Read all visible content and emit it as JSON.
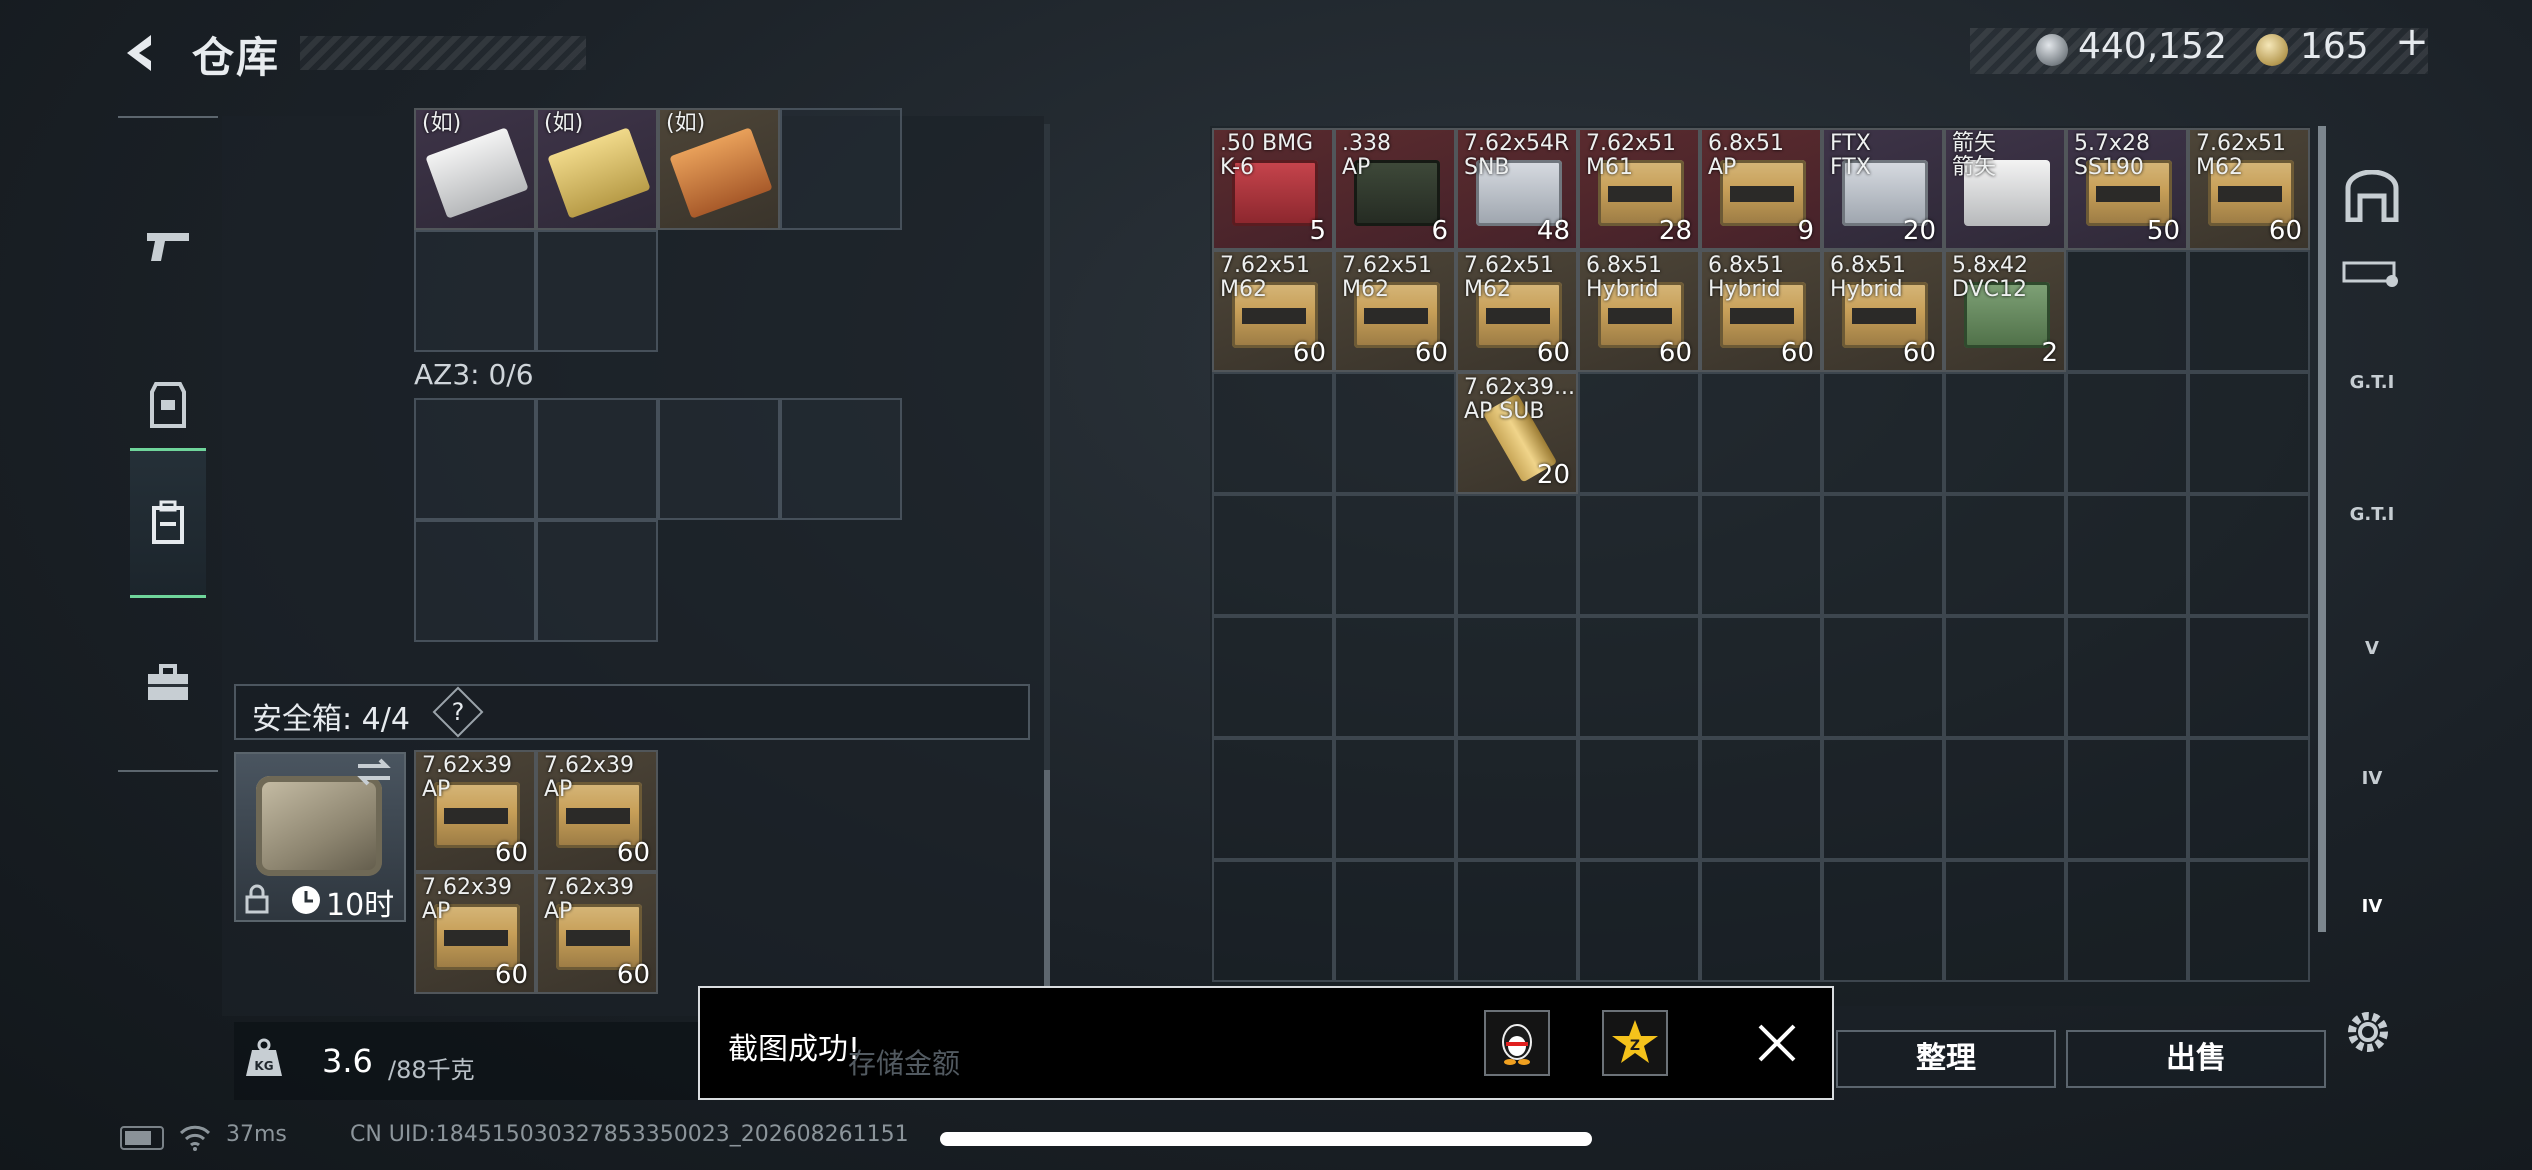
{
  "header": {
    "title": "仓库",
    "silver_amount": "440,152",
    "gold_amount": "165",
    "gold_plus": "+"
  },
  "left_panel": {
    "rig_top_items": [
      {
        "label": "(如)",
        "grade": "purple",
        "art": "pack-white"
      },
      {
        "label": "(如)",
        "grade": "purple",
        "art": "pack-white"
      },
      {
        "label": "(如)",
        "grade": "brown",
        "art": "pack-white"
      }
    ],
    "az3_label": "AZ3: 0/6",
    "safe_label": "安全箱: 4/4",
    "safe_help": "?",
    "safe_timer": "10时",
    "safe_items": [
      {
        "label": "7.62x39\nAP",
        "count": "60"
      },
      {
        "label": "7.62x39\nAP",
        "count": "60"
      },
      {
        "label": "7.62x39\nAP",
        "count": "60"
      },
      {
        "label": "7.62x39\nAP",
        "count": "60"
      }
    ],
    "weight_current": "3.6",
    "weight_max": "/88千克"
  },
  "warehouse": {
    "items": [
      {
        "label": ".50 BMG\nK-6",
        "count": "5",
        "grade": "red",
        "art": "ammo-box-red",
        "col": 0,
        "row": 0
      },
      {
        "label": ".338\nAP",
        "count": "6",
        "grade": "red",
        "art": "ammo-can",
        "col": 1,
        "row": 0
      },
      {
        "label": "7.62x54R\nSNB",
        "count": "48",
        "grade": "red",
        "art": "ammo-box-silver",
        "col": 2,
        "row": 0
      },
      {
        "label": "7.62x51\nM61",
        "count": "28",
        "grade": "red",
        "art": "ammo-box",
        "col": 3,
        "row": 0
      },
      {
        "label": "6.8x51\nAP",
        "count": "9",
        "grade": "red",
        "art": "ammo-box",
        "col": 4,
        "row": 0
      },
      {
        "label": "FTX\nFTX",
        "count": "20",
        "grade": "purple",
        "art": "ammo-box-silver",
        "col": 5,
        "row": 0
      },
      {
        "label": "箭矢\n箭矢",
        "count": "",
        "grade": "purple",
        "art": "pack-white",
        "col": 6,
        "row": 0
      },
      {
        "label": "5.7x28\nSS190",
        "count": "50",
        "grade": "purple",
        "art": "ammo-box",
        "col": 7,
        "row": 0
      },
      {
        "label": "7.62x51\nM62",
        "count": "60",
        "grade": "brown",
        "art": "ammo-box",
        "col": 8,
        "row": 0
      },
      {
        "label": "7.62x51\nM62",
        "count": "60",
        "grade": "brown",
        "art": "ammo-box",
        "col": 0,
        "row": 1
      },
      {
        "label": "7.62x51\nM62",
        "count": "60",
        "grade": "brown",
        "art": "ammo-box",
        "col": 1,
        "row": 1
      },
      {
        "label": "7.62x51\nM62",
        "count": "60",
        "grade": "brown",
        "art": "ammo-box",
        "col": 2,
        "row": 1
      },
      {
        "label": "6.8x51\nHybrid",
        "count": "60",
        "grade": "brown",
        "art": "ammo-box",
        "col": 3,
        "row": 1
      },
      {
        "label": "6.8x51\nHybrid",
        "count": "60",
        "grade": "brown",
        "art": "ammo-box",
        "col": 4,
        "row": 1
      },
      {
        "label": "6.8x51\nHybrid",
        "count": "60",
        "grade": "brown",
        "art": "ammo-box",
        "col": 5,
        "row": 1
      },
      {
        "label": "5.8x42\nDVC12",
        "count": "2",
        "grade": "brown",
        "art": "ammo-box-green",
        "col": 6,
        "row": 1
      },
      {
        "label": "7.62x39...\nAP SUB",
        "count": "20",
        "grade": "brown",
        "art": "bullet",
        "col": 2,
        "row": 2
      }
    ]
  },
  "right_tabs": [
    "",
    "",
    "G.T.I",
    "G.T.I",
    "V",
    "IV",
    "IV"
  ],
  "buttons": {
    "sort": "整理",
    "sell": "出售"
  },
  "toast": {
    "text": "截图成功!",
    "underlying_text": "存储金额"
  },
  "status": {
    "ping": "37ms",
    "uid": "CN UID:184515030327853350023_202608261151"
  },
  "colors": {
    "accent_green": "#6fd59b",
    "grade_red": "#5a2b2e",
    "grade_brown": "#4d4538",
    "grade_purple": "#3e3448"
  }
}
